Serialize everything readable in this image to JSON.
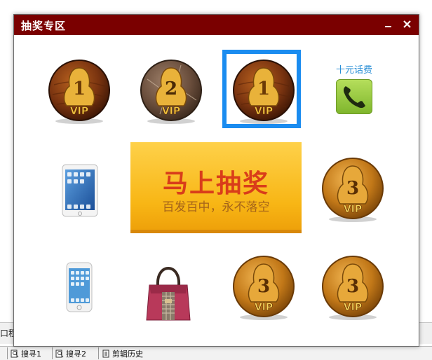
{
  "window": {
    "title": "抽奖专区",
    "minimize_symbol": "_",
    "close_symbol": "×"
  },
  "prizes": {
    "vip1_a": {
      "number": "1",
      "badge": "VIP",
      "icon": "vip-coin-wood"
    },
    "vip2": {
      "number": "2",
      "badge": "VIP",
      "icon": "vip-coin-stone"
    },
    "vip1_b": {
      "number": "1",
      "badge": "VIP",
      "icon": "vip-coin-wood",
      "selected": true
    },
    "phone_credit": {
      "label": "十元话费",
      "icon": "phone-icon"
    },
    "ipad": {
      "icon": "tablet-icon"
    },
    "vip3_a": {
      "number": "3",
      "badge": "VIP",
      "icon": "vip-coin-gold"
    },
    "iphone": {
      "icon": "phone-device-icon"
    },
    "handbag": {
      "icon": "handbag-icon"
    },
    "vip3_b": {
      "number": "3",
      "badge": "VIP",
      "icon": "vip-coin-gold"
    },
    "vip3_c": {
      "number": "3",
      "badge": "VIP",
      "icon": "vip-coin-gold"
    }
  },
  "draw_button": {
    "label": "马上抽奖",
    "sublabel": "百发百中，永不落空"
  },
  "background": {
    "left_text": "口程",
    "bottom_tabs": [
      "搜寻1",
      "搜寻2",
      "剪辑历史"
    ]
  },
  "colors": {
    "titlebar": "#7a0000",
    "selection": "#1a8cf0",
    "button_text": "#d93d1a"
  }
}
